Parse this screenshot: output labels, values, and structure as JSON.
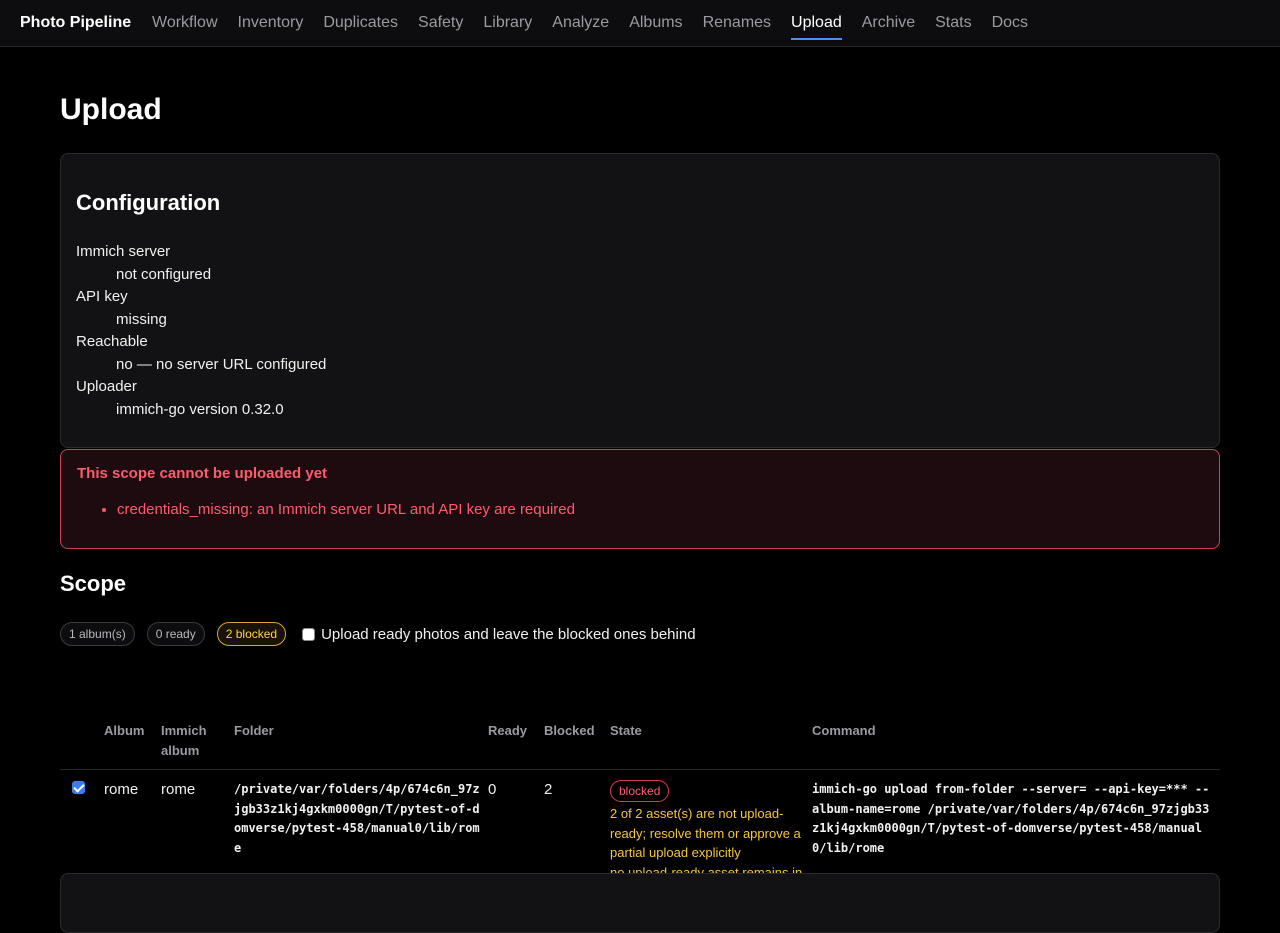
{
  "nav": {
    "brand": "Photo Pipeline",
    "links": [
      "Workflow",
      "Inventory",
      "Duplicates",
      "Safety",
      "Library",
      "Analyze",
      "Albums",
      "Renames",
      "Upload",
      "Archive",
      "Stats",
      "Docs"
    ],
    "active": "Upload"
  },
  "page": {
    "title": "Upload"
  },
  "config": {
    "title": "Configuration",
    "items": [
      {
        "term": "Immich server",
        "value": "not configured"
      },
      {
        "term": "API key",
        "value": "missing"
      },
      {
        "term": "Reachable",
        "value": "no — no server URL configured"
      },
      {
        "term": "Uploader",
        "value": "immich-go version 0.32.0"
      }
    ]
  },
  "alert": {
    "title": "This scope cannot be uploaded yet",
    "items": [
      "credentials_missing: an Immich server URL and API key are required"
    ],
    "color": "#ff5b6e"
  },
  "scope": {
    "title": "Scope",
    "pills": {
      "albums": "1 album(s)",
      "ready": "0 ready",
      "blocked": "2 blocked"
    },
    "partial_label": "Upload ready photos and leave the blocked ones behind",
    "partial_checked": false,
    "columns": {
      "album": "Album",
      "immich_album": "Immich album",
      "folder": "Folder",
      "ready": "Ready",
      "blocked": "Blocked",
      "state": "State",
      "command": "Command"
    },
    "rows": [
      {
        "checked": true,
        "album": "rome",
        "immich_album": "rome",
        "folder": "/private/var/folders/4p/674c6n_97zjgb33z1kj4gxkm0000gn/T/pytest-of-domverse/pytest-458/manual0/lib/rome",
        "ready": "0",
        "blocked": "2",
        "state": "blocked",
        "state_messages": [
          "2 of 2 asset(s) are not upload-ready; resolve them or approve a partial upload explicitly",
          "no upload-ready asset remains in this album"
        ],
        "command": "immich-go upload from-folder --server= --api-key=*** --album-name=rome /private/var/folders/4p/674c6n_97zjgb33z1kj4gxkm0000gn/T/pytest-of-domverse/pytest-458/manual0/lib/rome"
      }
    ]
  },
  "colors": {
    "accent": "#4a8ff7",
    "danger": "#ff5b6e",
    "warning": "#f5c542"
  }
}
